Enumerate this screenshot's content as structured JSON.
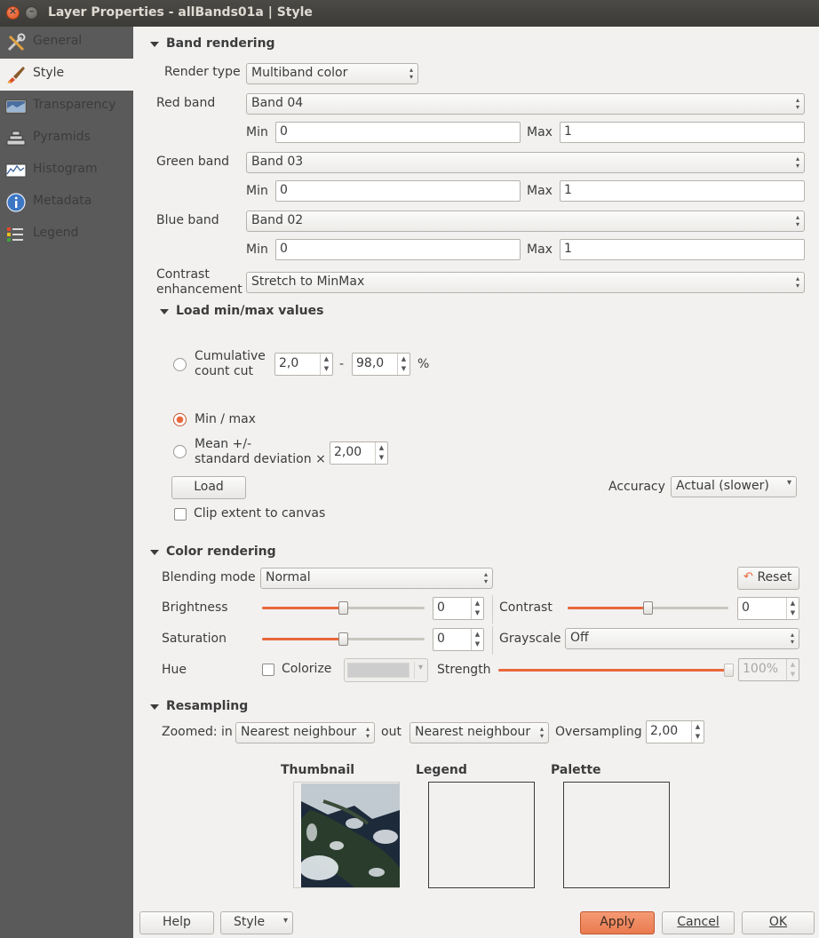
{
  "window": {
    "title": "Layer Properties - allBands01a | Style"
  },
  "sidebar": {
    "items": [
      {
        "label": "General",
        "icon": "wrench-icon"
      },
      {
        "label": "Style",
        "icon": "paintbrush-icon"
      },
      {
        "label": "Transparency",
        "icon": "transparency-icon"
      },
      {
        "label": "Pyramids",
        "icon": "pyramid-icon"
      },
      {
        "label": "Histogram",
        "icon": "histogram-icon"
      },
      {
        "label": "Metadata",
        "icon": "info-icon"
      },
      {
        "label": "Legend",
        "icon": "legend-icon"
      }
    ],
    "active": "Style"
  },
  "band_rendering": {
    "title": "Band rendering",
    "render_type_label": "Render type",
    "render_type": "Multiband color",
    "red_label": "Red band",
    "red": "Band 04",
    "green_label": "Green band",
    "green": "Band 03",
    "blue_label": "Blue band",
    "blue": "Band 02",
    "min_label": "Min",
    "max_label": "Max",
    "red_min": "0",
    "red_max": "1",
    "green_min": "0",
    "green_max": "1",
    "blue_min": "0",
    "blue_max": "1",
    "contrast_label_1": "Contrast",
    "contrast_label_2": "enhancement",
    "contrast": "Stretch to MinMax"
  },
  "minmax": {
    "title": "Load min/max values",
    "cumulative_label_1": "Cumulative",
    "cumulative_label_2": "count cut",
    "cut_low": "2,0",
    "cut_dash": "-",
    "cut_high": "98,0",
    "cut_unit": "%",
    "minmax_label": "Min / max",
    "mean_label_1": "Mean +/-",
    "mean_label_2": "standard deviation ×",
    "stddev": "2,00",
    "load_button": "Load",
    "accuracy_label": "Accuracy",
    "accuracy": "Actual (slower)",
    "clip_label": "Clip extent to canvas",
    "selected": "Min / max"
  },
  "color_rendering": {
    "title": "Color rendering",
    "blending_label": "Blending mode",
    "blending": "Normal",
    "reset_button": "Reset",
    "brightness_label": "Brightness",
    "brightness": "0",
    "brightness_level": 0.5,
    "contrast_label": "Contrast",
    "contrast": "0",
    "contrast_level": 0.5,
    "saturation_label": "Saturation",
    "saturation": "0",
    "saturation_level": 0.5,
    "grayscale_label": "Grayscale",
    "grayscale": "Off",
    "hue_label": "Hue",
    "colorize_label": "Colorize",
    "strength_label": "Strength",
    "strength": "100%",
    "strength_level": 1.0
  },
  "resampling": {
    "title": "Resampling",
    "zoomed_in_label": "Zoomed: in",
    "zoomed_in": "Nearest neighbour",
    "out_label": "out",
    "zoomed_out": "Nearest neighbour",
    "oversampling_label": "Oversampling",
    "oversampling": "2,00"
  },
  "previews": {
    "thumbnail_label": "Thumbnail",
    "legend_label": "Legend",
    "palette_label": "Palette"
  },
  "buttons": {
    "help": "Help",
    "style": "Style",
    "apply": "Apply",
    "cancel": "Cancel",
    "ok": "OK"
  },
  "colors": {
    "accent": "#e9673c",
    "sidebar_bg": "#5a5a5a",
    "window_bg": "#f2f1f0"
  }
}
